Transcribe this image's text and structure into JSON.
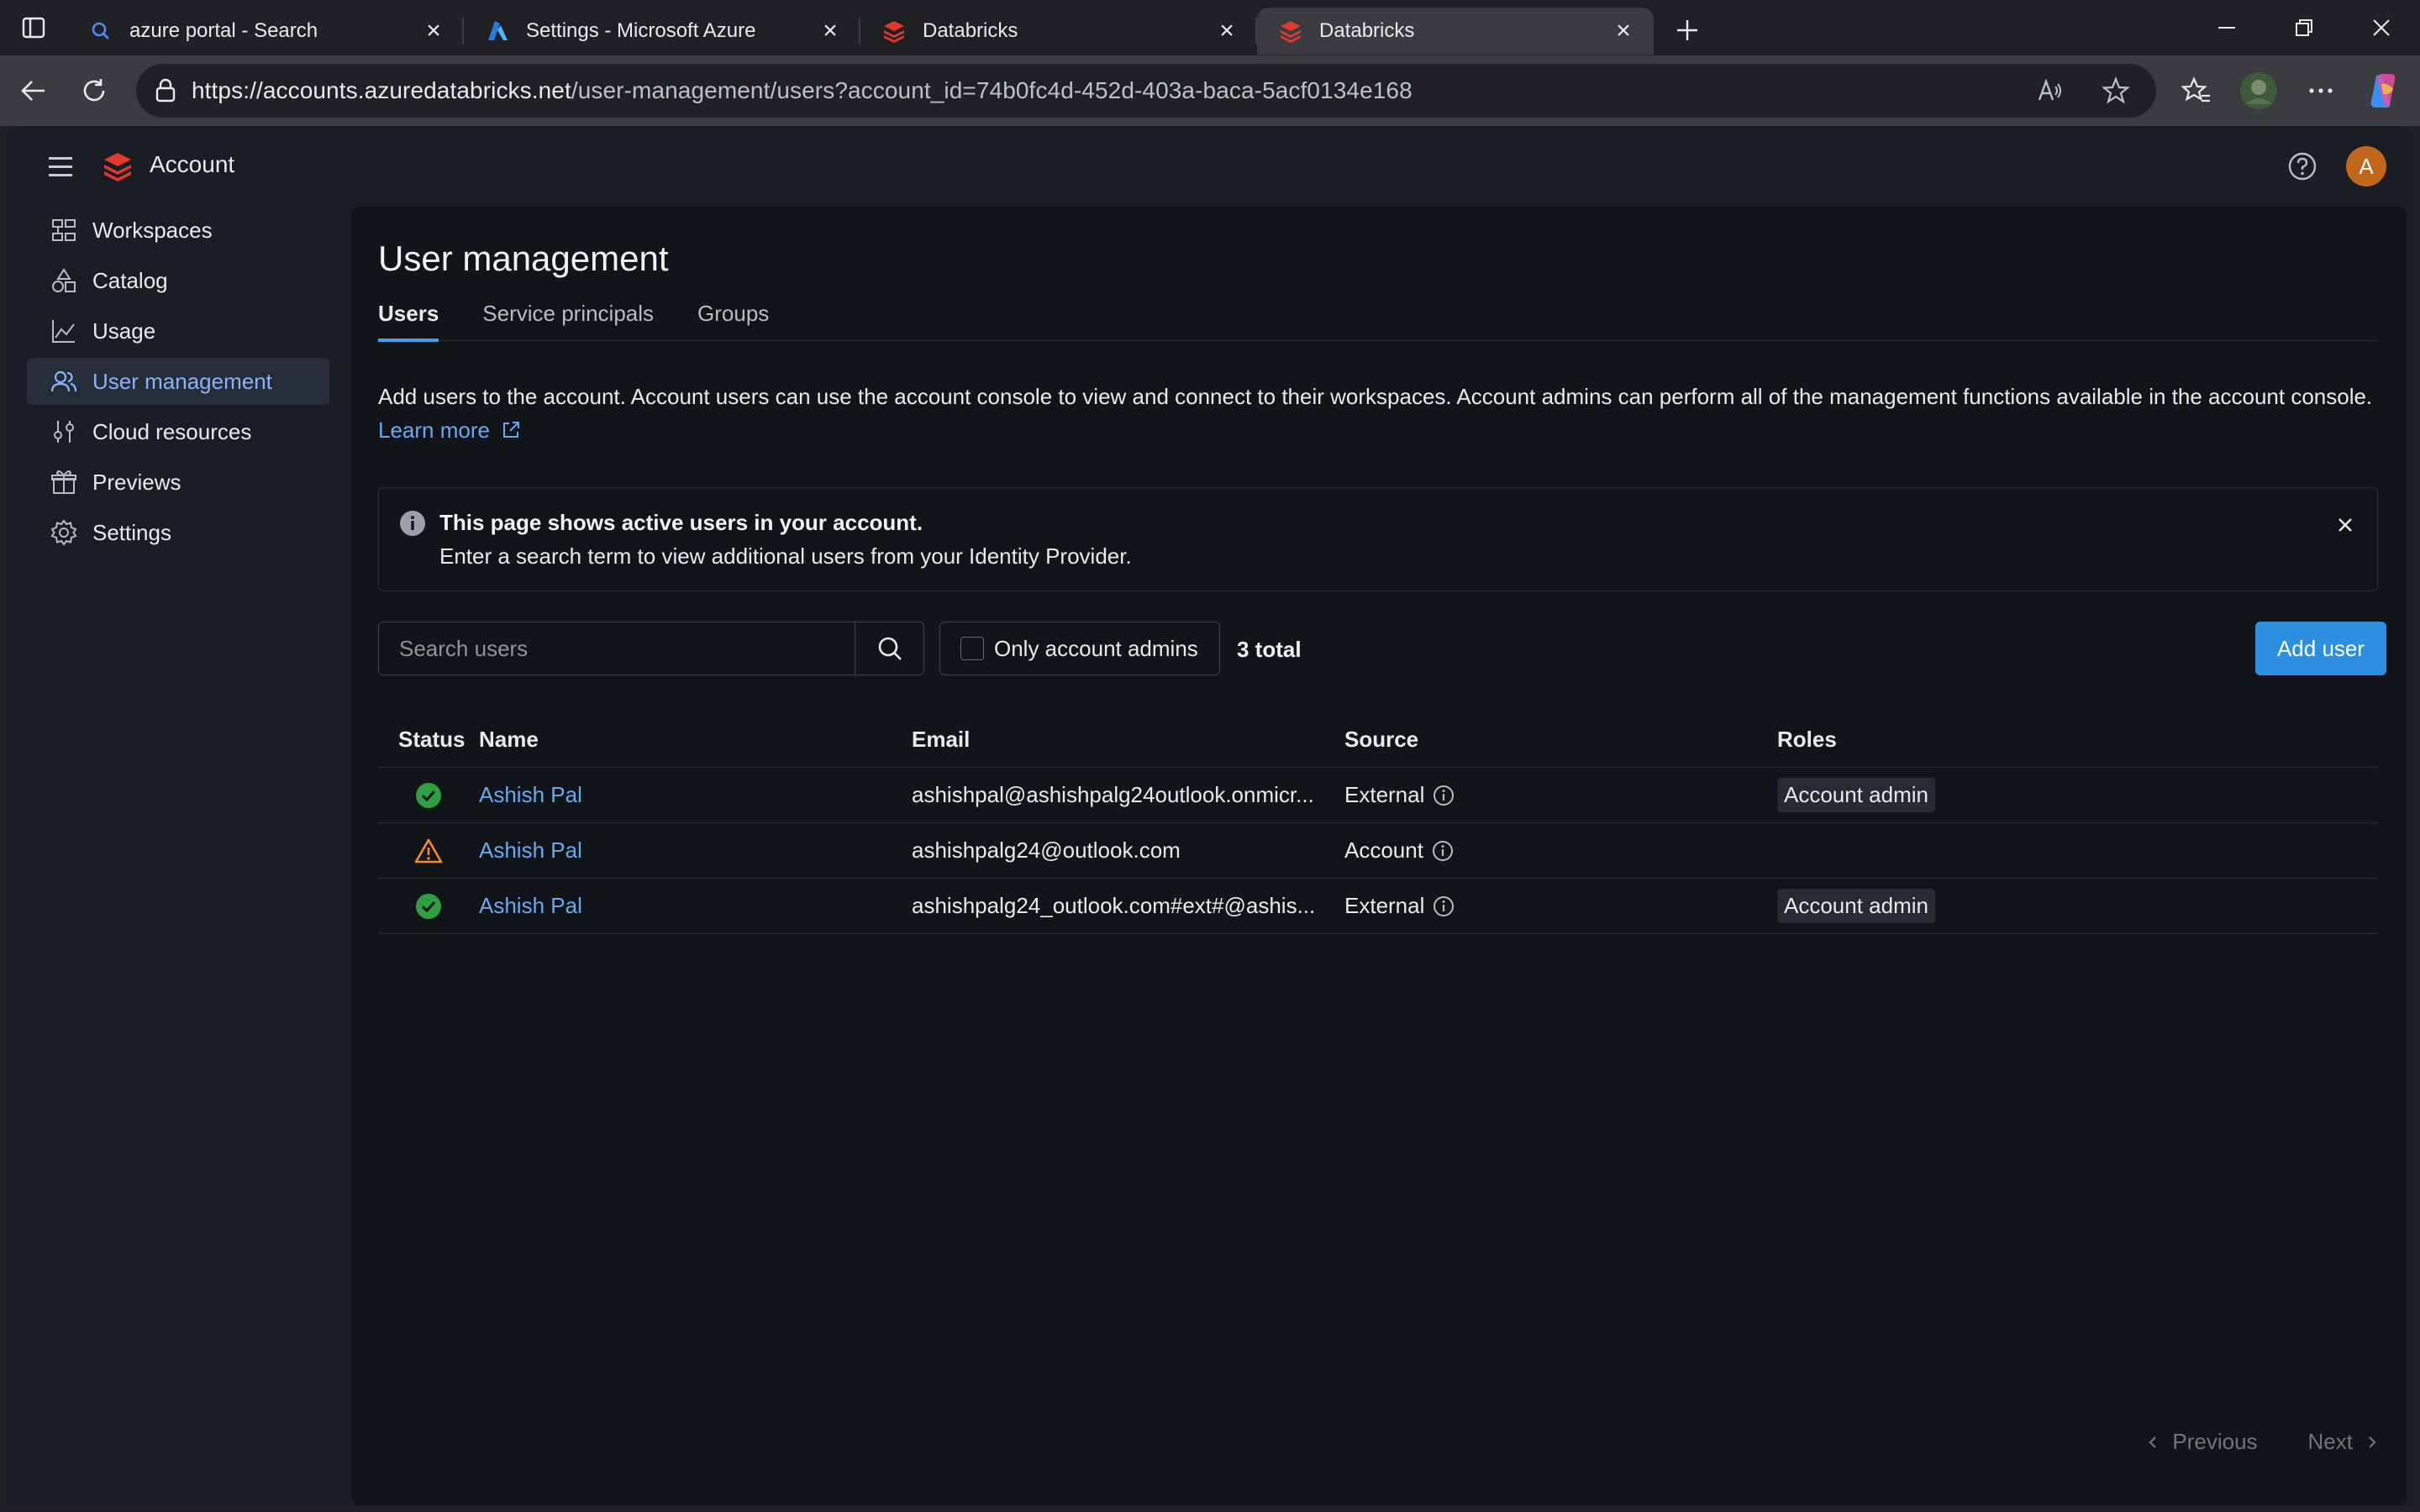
{
  "browser": {
    "tabs": [
      {
        "title": "azure portal - Search",
        "icon": "search-icon",
        "active": false
      },
      {
        "title": "Settings - Microsoft Azure",
        "icon": "azure-icon",
        "active": false
      },
      {
        "title": "Databricks",
        "icon": "databricks-icon",
        "active": false
      },
      {
        "title": "Databricks",
        "icon": "databricks-icon",
        "active": true
      }
    ],
    "url": {
      "host": "https://accounts.azuredatabricks.net",
      "path": "/user-management/users?account_id=74b0fc4d-452d-403a-baca-5acf0134e168"
    }
  },
  "app": {
    "brand": "Account",
    "avatar_letter": "A"
  },
  "sidebar": {
    "items": [
      {
        "label": "Workspaces",
        "icon": "workspaces-icon"
      },
      {
        "label": "Catalog",
        "icon": "catalog-icon"
      },
      {
        "label": "Usage",
        "icon": "usage-icon"
      },
      {
        "label": "User management",
        "icon": "users-icon",
        "active": true
      },
      {
        "label": "Cloud resources",
        "icon": "cloud-resources-icon"
      },
      {
        "label": "Previews",
        "icon": "previews-icon"
      },
      {
        "label": "Settings",
        "icon": "gear-icon"
      }
    ]
  },
  "page": {
    "title": "User management",
    "tabs": [
      "Users",
      "Service principals",
      "Groups"
    ],
    "description": "Add users to the account. Account users can use the account console to view and connect to their workspaces. Account admins can perform all of the management functions available in the account console.",
    "learn_more": "Learn more",
    "banner": {
      "title": "This page shows active users in your account.",
      "body": "Enter a search term to view additional users from your Identity Provider."
    },
    "search_placeholder": "Search users",
    "filter_label": "Only account admins",
    "total": "3 total",
    "add_user": "Add user",
    "columns": [
      "Status",
      "Name",
      "Email",
      "Source",
      "Roles"
    ],
    "rows": [
      {
        "status": "active",
        "name": "Ashish Pal",
        "email": "ashishpal@ashishpalg24outlook.onmicr...",
        "source": "External",
        "role": "Account admin"
      },
      {
        "status": "warning",
        "name": "Ashish Pal",
        "email": "ashishpalg24@outlook.com",
        "source": "Account",
        "role": ""
      },
      {
        "status": "active",
        "name": "Ashish Pal",
        "email": "ashishpalg24_outlook.com#ext#@ashis...",
        "source": "External",
        "role": "Account admin"
      }
    ],
    "pager": {
      "previous": "Previous",
      "next": "Next"
    }
  },
  "colors": {
    "accent": "#2d8fe0",
    "link": "#6aa9f0",
    "status_active": "#2ea043",
    "status_warning": "#f08b2c",
    "brand_red": "#e2382d"
  }
}
